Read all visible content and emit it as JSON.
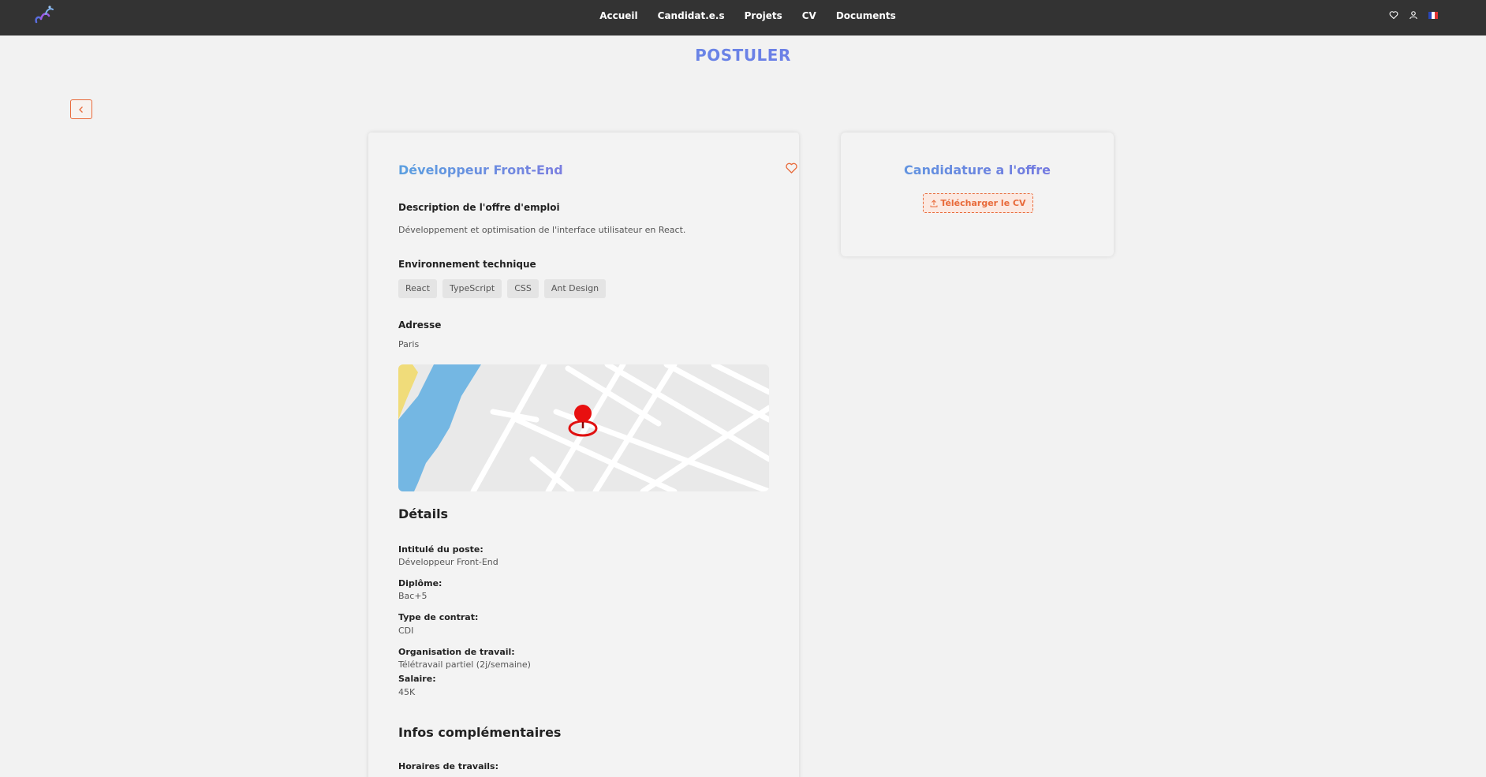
{
  "nav": {
    "logo": "logo-icon",
    "items": [
      {
        "label": "Accueil"
      },
      {
        "label": "Candidat.e.s"
      },
      {
        "label": "Projets"
      },
      {
        "label": "CV"
      },
      {
        "label": "Documents"
      }
    ],
    "icons": [
      "heart-icon",
      "user-icon",
      "flag-fr-icon"
    ]
  },
  "page": {
    "title": "POSTULER"
  },
  "offer": {
    "title": "Développeur Front-End",
    "description_label": "Description de l'offre d'emploi",
    "description": "Développement et optimisation de l'interface utilisateur en React.",
    "environment_label": "Environnement technique",
    "tags": [
      "React",
      "TypeScript",
      "CSS",
      "Ant Design"
    ],
    "address_label": "Adresse",
    "address": "Paris",
    "details_heading": "Détails",
    "details": [
      {
        "label": "Intitulé du poste:",
        "value": "Développeur Front-End"
      },
      {
        "label": "Diplôme:",
        "value": "Bac+5"
      },
      {
        "label": "Type de contrat:",
        "value": "CDI"
      },
      {
        "label": "Organisation de travail:",
        "value": "Télétravail partiel (2j/semaine)"
      },
      {
        "label": "Salaire:",
        "value": "45K"
      }
    ],
    "extra_heading": "Infos complémentaires",
    "extra": [
      {
        "label": "Horaires de travails:"
      }
    ]
  },
  "application": {
    "title": "Candidature a l'offre",
    "download_label": "Télécharger le CV"
  },
  "colors": {
    "topbar": "#333333",
    "accent_orange": "#e86a3a",
    "title_blue": "#5aa7e6",
    "title_purple": "#7b5ce6",
    "background": "#f2f2f2"
  }
}
